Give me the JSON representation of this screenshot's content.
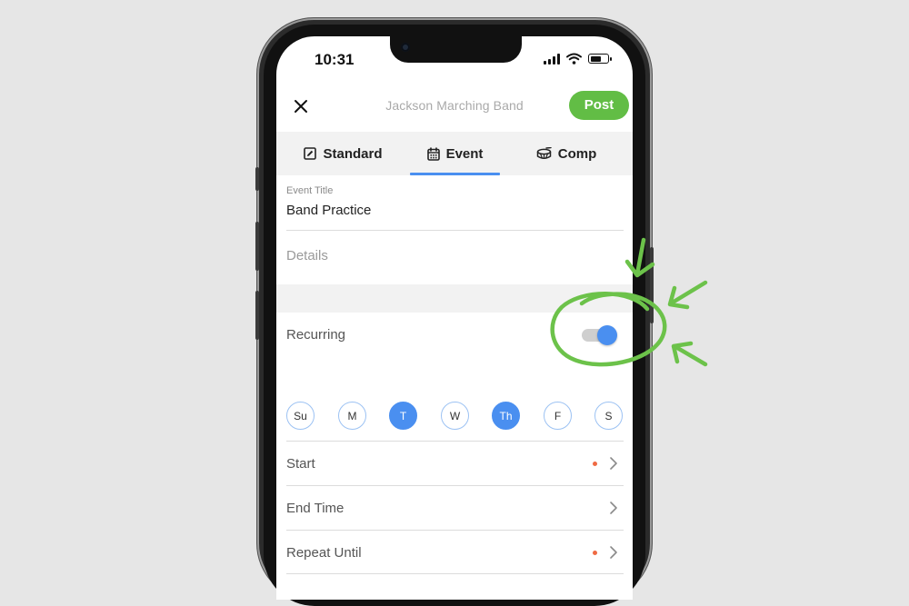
{
  "status_bar": {
    "time": "10:31",
    "battery_level": 0.62
  },
  "header": {
    "title": "Jackson Marching Band",
    "post_label": "Post",
    "close_icon": "close-icon"
  },
  "tabs": [
    {
      "label": "Standard",
      "icon": "edit-icon",
      "active": false
    },
    {
      "label": "Event",
      "icon": "calendar-icon",
      "active": true
    },
    {
      "label": "Comp",
      "icon": "drum-icon",
      "active": false
    }
  ],
  "form": {
    "event_title_label": "Event Title",
    "event_title_value": "Band Practice",
    "details_placeholder": "Details",
    "recurring_label": "Recurring",
    "recurring_on": true,
    "days": [
      {
        "label": "Su",
        "selected": false
      },
      {
        "label": "M",
        "selected": false
      },
      {
        "label": "T",
        "selected": true
      },
      {
        "label": "W",
        "selected": false
      },
      {
        "label": "Th",
        "selected": true
      },
      {
        "label": "F",
        "selected": false
      },
      {
        "label": "S",
        "selected": false
      }
    ],
    "rows": [
      {
        "label": "Start",
        "required": true
      },
      {
        "label": "End Time",
        "required": false
      },
      {
        "label": "Repeat Until",
        "required": true
      }
    ]
  },
  "colors": {
    "accent_green": "#62bd45",
    "accent_blue": "#4a8ff0",
    "required_dot": "#ef6a43",
    "annotation_green": "#6cc24a"
  },
  "annotation": {
    "type": "hand-drawn circle and arrows highlighting the recurring toggle"
  }
}
